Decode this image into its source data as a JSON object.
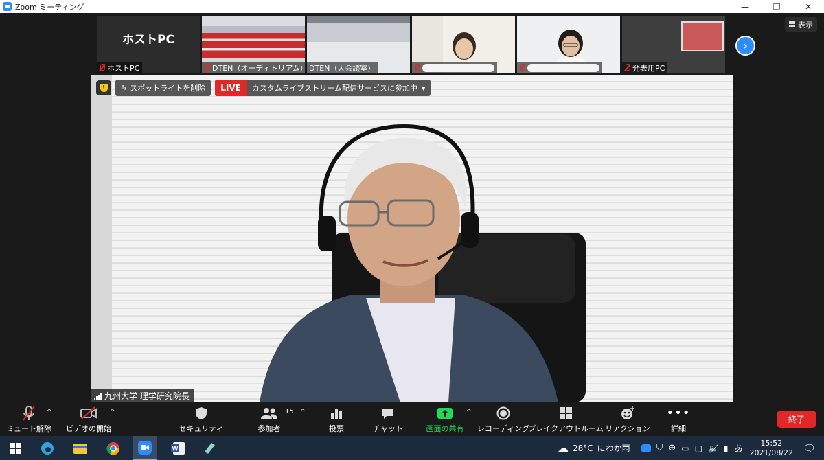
{
  "window": {
    "title": "Zoom ミーティング"
  },
  "view_button": {
    "label": "表示"
  },
  "thumbnails": [
    {
      "name": "ホストPC",
      "big_label": "ホストPC",
      "muted": true
    },
    {
      "name": "DTEN（オーディトリアム）",
      "muted": true
    },
    {
      "name": "DTEN（大会議室）",
      "muted": false
    },
    {
      "name": "",
      "muted": true
    },
    {
      "name": "",
      "muted": true
    },
    {
      "name": "発表用PC",
      "muted": true
    }
  ],
  "spotlight": {
    "label": "スポットライトを削除"
  },
  "live": {
    "tag": "LIVE",
    "text": "カスタムライブストリーム配信サービスに参加中"
  },
  "speaker": {
    "name": "九州大学 理学研究院長"
  },
  "toolbar": {
    "mute": "ミュート解除",
    "video": "ビデオの開始",
    "security": "セキュリティ",
    "participants": "参加者",
    "participants_count": "15",
    "polls": "投票",
    "chat": "チャット",
    "share": "画面の共有",
    "record": "レコーディング",
    "breakout": "ブレイクアウトルーム",
    "reactions": "リアクション",
    "more": "詳細",
    "end": "終了"
  },
  "taskbar": {
    "weather_temp": "28°C",
    "weather_text": "にわか雨",
    "ime": "あ",
    "time": "15:52",
    "date": "2021/08/22"
  },
  "colors": {
    "accent": "#2d8cff",
    "danger": "#e02828",
    "share_green": "#23d959"
  }
}
